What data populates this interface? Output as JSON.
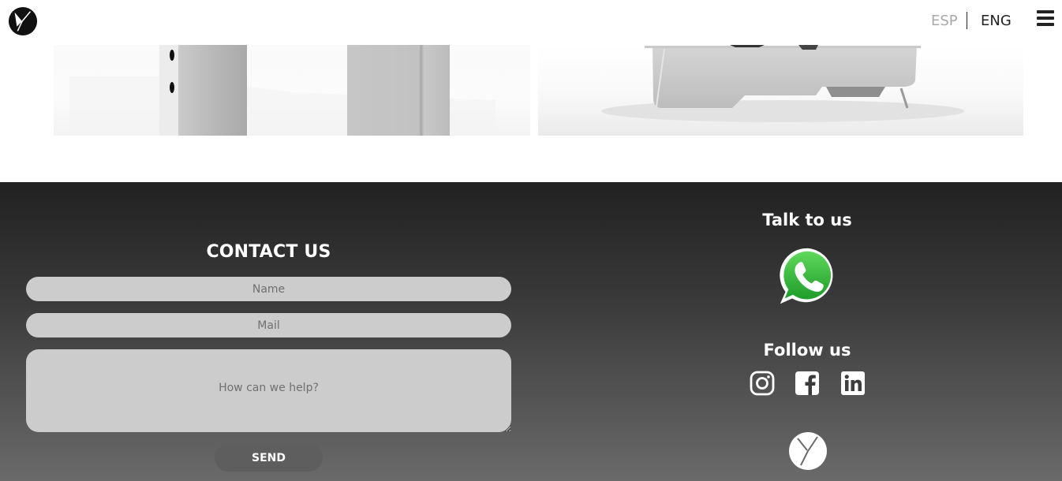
{
  "header": {
    "lang_esp": "ESP",
    "lang_eng": "ENG",
    "logo_icon": "brand-logo-icon",
    "menu_icon": "hamburger-menu-icon"
  },
  "contact": {
    "title": "CONTACT US",
    "name_placeholder": "Name",
    "mail_placeholder": "Mail",
    "message_placeholder": "How can we help?",
    "send_label": "SEND"
  },
  "talk": {
    "title": "Talk to us",
    "icon": "whatsapp-icon"
  },
  "follow": {
    "title": "Follow us",
    "icons": [
      "instagram-icon",
      "facebook-icon",
      "linkedin-icon"
    ]
  },
  "colors": {
    "footer_top": "#212121",
    "footer_bottom": "#6a6a6a",
    "input_bg": "#cccccc",
    "send_bg": "#5e5e5e",
    "whatsapp_green": "#3fc04a"
  }
}
